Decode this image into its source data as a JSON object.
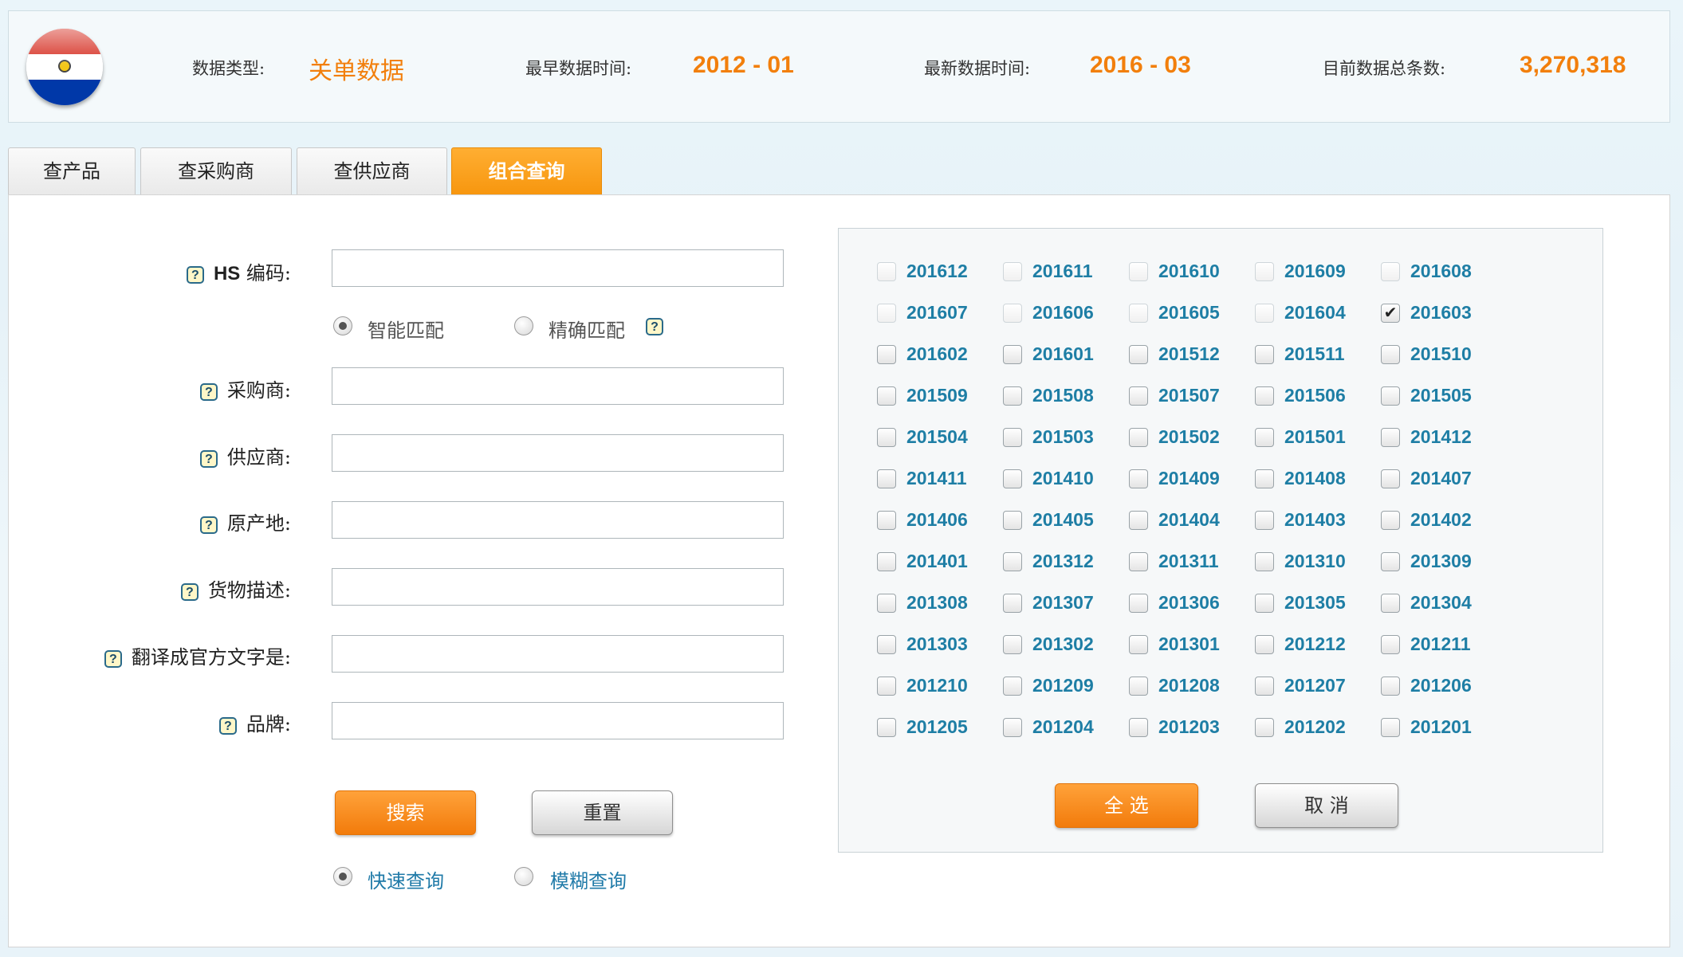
{
  "header": {
    "data_type_label": "数据类型:",
    "data_type_value": "关单数据",
    "earliest_label": "最早数据时间:",
    "earliest_value": "2012 - 01",
    "latest_label": "最新数据时间:",
    "latest_value": "2016 - 03",
    "total_label": "目前数据总条数:",
    "total_value": "3,270,318",
    "flag_icon": "paraguay-flag-icon"
  },
  "tabs": [
    {
      "label": "查产品",
      "active": false
    },
    {
      "label": "查采购商",
      "active": false
    },
    {
      "label": "查供应商",
      "active": false
    },
    {
      "label": "组合查询",
      "active": true
    }
  ],
  "form": {
    "hs_code": {
      "label_bold": "HS",
      "label": " 编码:",
      "value": ""
    },
    "match_options": [
      {
        "label": "智能匹配",
        "selected": true
      },
      {
        "label": "精确匹配",
        "selected": false
      }
    ],
    "fields": [
      {
        "label": "采购商:",
        "value": ""
      },
      {
        "label": "供应商:",
        "value": ""
      },
      {
        "label": "原产地:",
        "value": ""
      },
      {
        "label": "货物描述:",
        "value": ""
      },
      {
        "label": "翻译成官方文字是:",
        "value": ""
      },
      {
        "label": "品牌:",
        "value": ""
      }
    ],
    "search_button": "搜索",
    "reset_button": "重置",
    "query_modes": [
      {
        "label": "快速查询",
        "selected": true
      },
      {
        "label": "模糊查询",
        "selected": false
      }
    ]
  },
  "months": {
    "items": [
      {
        "label": "201612",
        "checked": false,
        "available": false
      },
      {
        "label": "201611",
        "checked": false,
        "available": false
      },
      {
        "label": "201610",
        "checked": false,
        "available": false
      },
      {
        "label": "201609",
        "checked": false,
        "available": false
      },
      {
        "label": "201608",
        "checked": false,
        "available": false
      },
      {
        "label": "201607",
        "checked": false,
        "available": false
      },
      {
        "label": "201606",
        "checked": false,
        "available": false
      },
      {
        "label": "201605",
        "checked": false,
        "available": false
      },
      {
        "label": "201604",
        "checked": false,
        "available": false
      },
      {
        "label": "201603",
        "checked": true,
        "available": true
      },
      {
        "label": "201602",
        "checked": false,
        "available": true
      },
      {
        "label": "201601",
        "checked": false,
        "available": true
      },
      {
        "label": "201512",
        "checked": false,
        "available": true
      },
      {
        "label": "201511",
        "checked": false,
        "available": true
      },
      {
        "label": "201510",
        "checked": false,
        "available": true
      },
      {
        "label": "201509",
        "checked": false,
        "available": true
      },
      {
        "label": "201508",
        "checked": false,
        "available": true
      },
      {
        "label": "201507",
        "checked": false,
        "available": true
      },
      {
        "label": "201506",
        "checked": false,
        "available": true
      },
      {
        "label": "201505",
        "checked": false,
        "available": true
      },
      {
        "label": "201504",
        "checked": false,
        "available": true
      },
      {
        "label": "201503",
        "checked": false,
        "available": true
      },
      {
        "label": "201502",
        "checked": false,
        "available": true
      },
      {
        "label": "201501",
        "checked": false,
        "available": true
      },
      {
        "label": "201412",
        "checked": false,
        "available": true
      },
      {
        "label": "201411",
        "checked": false,
        "available": true
      },
      {
        "label": "201410",
        "checked": false,
        "available": true
      },
      {
        "label": "201409",
        "checked": false,
        "available": true
      },
      {
        "label": "201408",
        "checked": false,
        "available": true
      },
      {
        "label": "201407",
        "checked": false,
        "available": true
      },
      {
        "label": "201406",
        "checked": false,
        "available": true
      },
      {
        "label": "201405",
        "checked": false,
        "available": true
      },
      {
        "label": "201404",
        "checked": false,
        "available": true
      },
      {
        "label": "201403",
        "checked": false,
        "available": true
      },
      {
        "label": "201402",
        "checked": false,
        "available": true
      },
      {
        "label": "201401",
        "checked": false,
        "available": true
      },
      {
        "label": "201312",
        "checked": false,
        "available": true
      },
      {
        "label": "201311",
        "checked": false,
        "available": true
      },
      {
        "label": "201310",
        "checked": false,
        "available": true
      },
      {
        "label": "201309",
        "checked": false,
        "available": true
      },
      {
        "label": "201308",
        "checked": false,
        "available": true
      },
      {
        "label": "201307",
        "checked": false,
        "available": true
      },
      {
        "label": "201306",
        "checked": false,
        "available": true
      },
      {
        "label": "201305",
        "checked": false,
        "available": true
      },
      {
        "label": "201304",
        "checked": false,
        "available": true
      },
      {
        "label": "201303",
        "checked": false,
        "available": true
      },
      {
        "label": "201302",
        "checked": false,
        "available": true
      },
      {
        "label": "201301",
        "checked": false,
        "available": true
      },
      {
        "label": "201212",
        "checked": false,
        "available": true
      },
      {
        "label": "201211",
        "checked": false,
        "available": true
      },
      {
        "label": "201210",
        "checked": false,
        "available": true
      },
      {
        "label": "201209",
        "checked": false,
        "available": true
      },
      {
        "label": "201208",
        "checked": false,
        "available": true
      },
      {
        "label": "201207",
        "checked": false,
        "available": true
      },
      {
        "label": "201206",
        "checked": false,
        "available": true
      },
      {
        "label": "201205",
        "checked": false,
        "available": true
      },
      {
        "label": "201204",
        "checked": false,
        "available": true
      },
      {
        "label": "201203",
        "checked": false,
        "available": true
      },
      {
        "label": "201202",
        "checked": false,
        "available": true
      },
      {
        "label": "201201",
        "checked": false,
        "available": true
      }
    ],
    "select_all_button": "全 选",
    "cancel_button": "取 消"
  },
  "colors": {
    "accent_orange": "#f27f0c",
    "month_label_blue": "#1e7ea5"
  }
}
